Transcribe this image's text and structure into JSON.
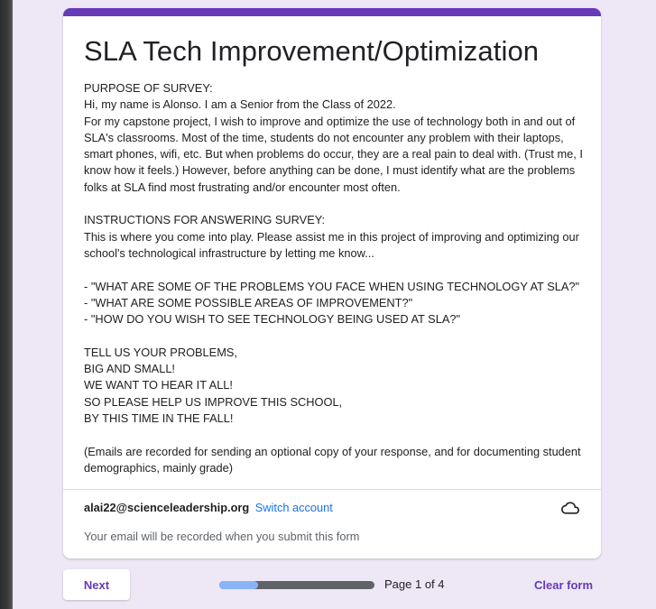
{
  "form": {
    "accent_color": "#673ab7",
    "title": "SLA Tech Improvement/Optimization",
    "description": "PURPOSE OF SURVEY:\nHi, my name is Alonso. I am a Senior from the Class of 2022.\nFor my capstone project, I wish to improve and optimize the use of technology both in and out of SLA's classrooms. Most of the time, students do not encounter any problem with their laptops, smart phones, wifi, etc. But when problems do occur, they are a real pain to deal with. (Trust me, I know how it feels.) However, before anything can be done, I must identify what are the problems folks at SLA find most frustrating and/or encounter most often.\n\nINSTRUCTIONS FOR ANSWERING SURVEY:\nThis is where you come into play. Please assist me in this project of improving and optimizing our school's technological infrastructure by letting me know...\n\n- \"WHAT ARE SOME OF THE PROBLEMS YOU FACE WHEN USING TECHNOLOGY AT SLA?\"\n- \"WHAT ARE SOME POSSIBLE AREAS OF IMPROVEMENT?\"\n- \"HOW DO YOU WISH TO SEE TECHNOLOGY BEING USED AT SLA?\"\n\nTELL US YOUR PROBLEMS,\nBIG AND SMALL!\nWE WANT TO HEAR IT ALL!\nSO PLEASE HELP US IMPROVE THIS SCHOOL,\nBY THIS TIME IN THE FALL!\n\n(Emails are recorded for sending an optional copy of your response, and for documenting student demographics, mainly grade)"
  },
  "account": {
    "email": "alai22@scienceleadership.org",
    "switch_label": "Switch account",
    "icon": "cloud-icon",
    "recorded_note": "Your email will be recorded when you submit this form"
  },
  "footer": {
    "next_label": "Next",
    "progress_fraction": 0.25,
    "page_indicator": "Page 1 of 4",
    "clear_label": "Clear form"
  }
}
